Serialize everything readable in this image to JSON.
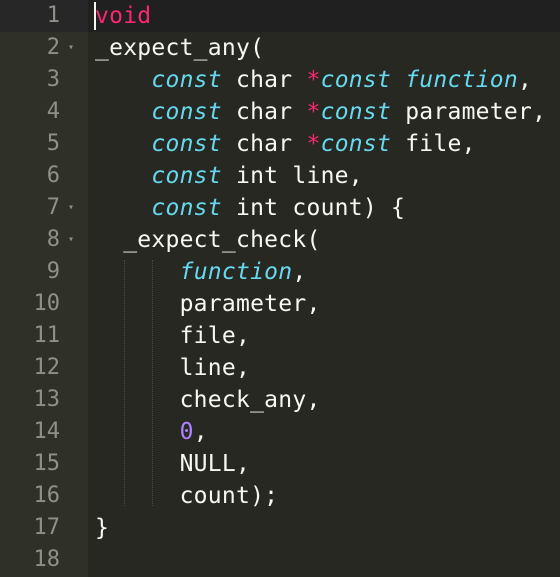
{
  "editor": {
    "lines": [
      {
        "num": "1",
        "fold": "",
        "segments": [
          {
            "cls": "red",
            "text": "void"
          }
        ]
      },
      {
        "num": "2",
        "fold": "▾",
        "segments": [
          {
            "cls": "fn",
            "text": "_expect_any("
          }
        ]
      },
      {
        "num": "3",
        "fold": "",
        "segments": [
          {
            "cls": "tp",
            "text": "    "
          },
          {
            "cls": "kw",
            "text": "const"
          },
          {
            "cls": "tp",
            "text": " char "
          },
          {
            "cls": "op",
            "text": "*"
          },
          {
            "cls": "kw",
            "text": "const"
          },
          {
            "cls": "tp",
            "text": " "
          },
          {
            "cls": "param-it",
            "text": "function"
          },
          {
            "cls": "tp",
            "text": ","
          }
        ]
      },
      {
        "num": "4",
        "fold": "",
        "segments": [
          {
            "cls": "tp",
            "text": "    "
          },
          {
            "cls": "kw",
            "text": "const"
          },
          {
            "cls": "tp",
            "text": " char "
          },
          {
            "cls": "op",
            "text": "*"
          },
          {
            "cls": "kw",
            "text": "const"
          },
          {
            "cls": "tp",
            "text": " parameter,"
          }
        ]
      },
      {
        "num": "5",
        "fold": "",
        "segments": [
          {
            "cls": "tp",
            "text": "    "
          },
          {
            "cls": "kw",
            "text": "const"
          },
          {
            "cls": "tp",
            "text": " char "
          },
          {
            "cls": "op",
            "text": "*"
          },
          {
            "cls": "kw",
            "text": "const"
          },
          {
            "cls": "tp",
            "text": " file,"
          }
        ]
      },
      {
        "num": "6",
        "fold": "",
        "segments": [
          {
            "cls": "tp",
            "text": "    "
          },
          {
            "cls": "kw",
            "text": "const"
          },
          {
            "cls": "tp",
            "text": " int line,"
          }
        ]
      },
      {
        "num": "7",
        "fold": "▾",
        "segments": [
          {
            "cls": "tp",
            "text": "    "
          },
          {
            "cls": "kw",
            "text": "const"
          },
          {
            "cls": "tp",
            "text": " int count) {"
          }
        ]
      },
      {
        "num": "8",
        "fold": "▾",
        "segments": [
          {
            "cls": "fn",
            "text": "  _expect_check("
          }
        ]
      },
      {
        "num": "9",
        "fold": "",
        "segments": [
          {
            "cls": "tp",
            "text": "      "
          },
          {
            "cls": "param-it",
            "text": "function"
          },
          {
            "cls": "tp",
            "text": ","
          }
        ]
      },
      {
        "num": "10",
        "fold": "",
        "segments": [
          {
            "cls": "tp",
            "text": "      parameter,"
          }
        ]
      },
      {
        "num": "11",
        "fold": "",
        "segments": [
          {
            "cls": "tp",
            "text": "      file,"
          }
        ]
      },
      {
        "num": "12",
        "fold": "",
        "segments": [
          {
            "cls": "tp",
            "text": "      line,"
          }
        ]
      },
      {
        "num": "13",
        "fold": "",
        "segments": [
          {
            "cls": "tp",
            "text": "      check_any,"
          }
        ]
      },
      {
        "num": "14",
        "fold": "",
        "segments": [
          {
            "cls": "tp",
            "text": "      "
          },
          {
            "cls": "num",
            "text": "0"
          },
          {
            "cls": "tp",
            "text": ","
          }
        ]
      },
      {
        "num": "15",
        "fold": "",
        "segments": [
          {
            "cls": "tp",
            "text": "      NULL,"
          }
        ]
      },
      {
        "num": "16",
        "fold": "",
        "segments": [
          {
            "cls": "tp",
            "text": "      count);"
          }
        ]
      },
      {
        "num": "17",
        "fold": "",
        "segments": [
          {
            "cls": "tp",
            "text": "}"
          }
        ]
      },
      {
        "num": "18",
        "fold": "",
        "segments": []
      }
    ],
    "active_line": "1",
    "colors": {
      "background": "#272822",
      "gutter": "#2f3129",
      "keyword": "#66d9ef",
      "operator": "#f92672",
      "number": "#ae81ff",
      "text": "#f8f8f2",
      "line_number": "#8f908a"
    }
  }
}
